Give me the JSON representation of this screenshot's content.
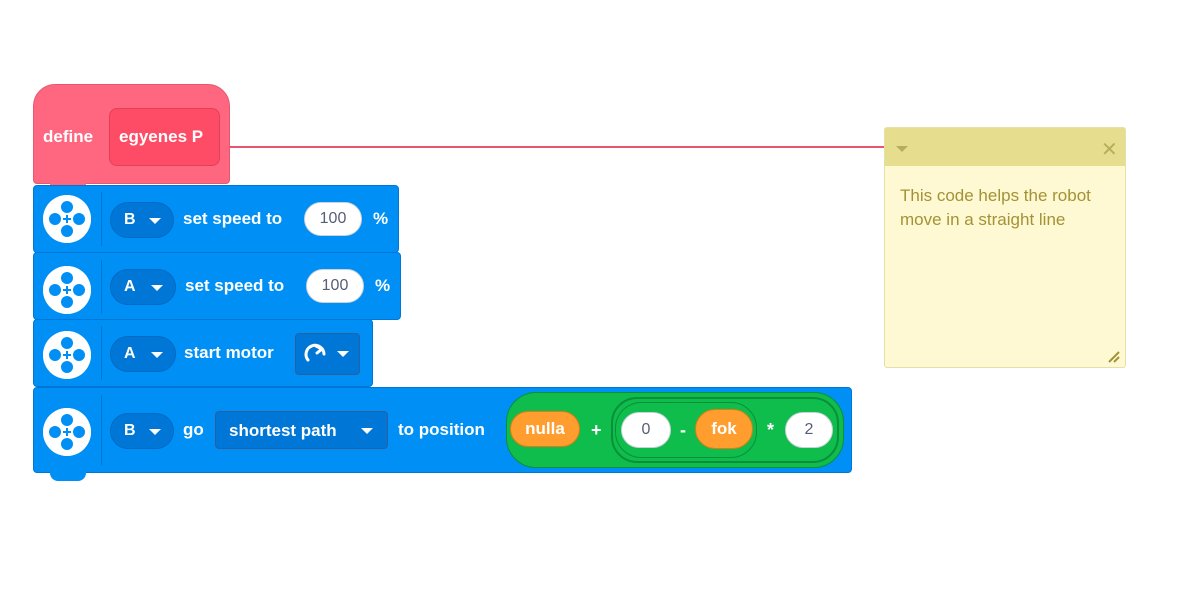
{
  "define_block": {
    "keyword": "define",
    "procedure_name": "egyenes P"
  },
  "blocks": [
    {
      "port": "B",
      "label": "set speed to",
      "value": "100",
      "unit": "%"
    },
    {
      "port": "A",
      "label": "set speed to",
      "value": "100",
      "unit": "%"
    },
    {
      "port": "A",
      "label": "start motor",
      "direction_icon": "clockwise-arrow-icon"
    },
    {
      "port": "B",
      "label_go": "go",
      "path_option": "shortest path",
      "label_to": "to position",
      "expression": {
        "var1": "nulla",
        "op_plus": "+",
        "num_zero": "0",
        "op_minus": "-",
        "var2": "fok",
        "op_times": "*",
        "num_two": "2"
      }
    }
  ],
  "sticky_note": {
    "text": "This code helps the robot move in a straight line"
  },
  "colors": {
    "define": "#ff6680",
    "motor": "#0090f5",
    "operator": "#0fbd4c",
    "variable": "#ff9d2e",
    "note": "#fef8d3"
  }
}
